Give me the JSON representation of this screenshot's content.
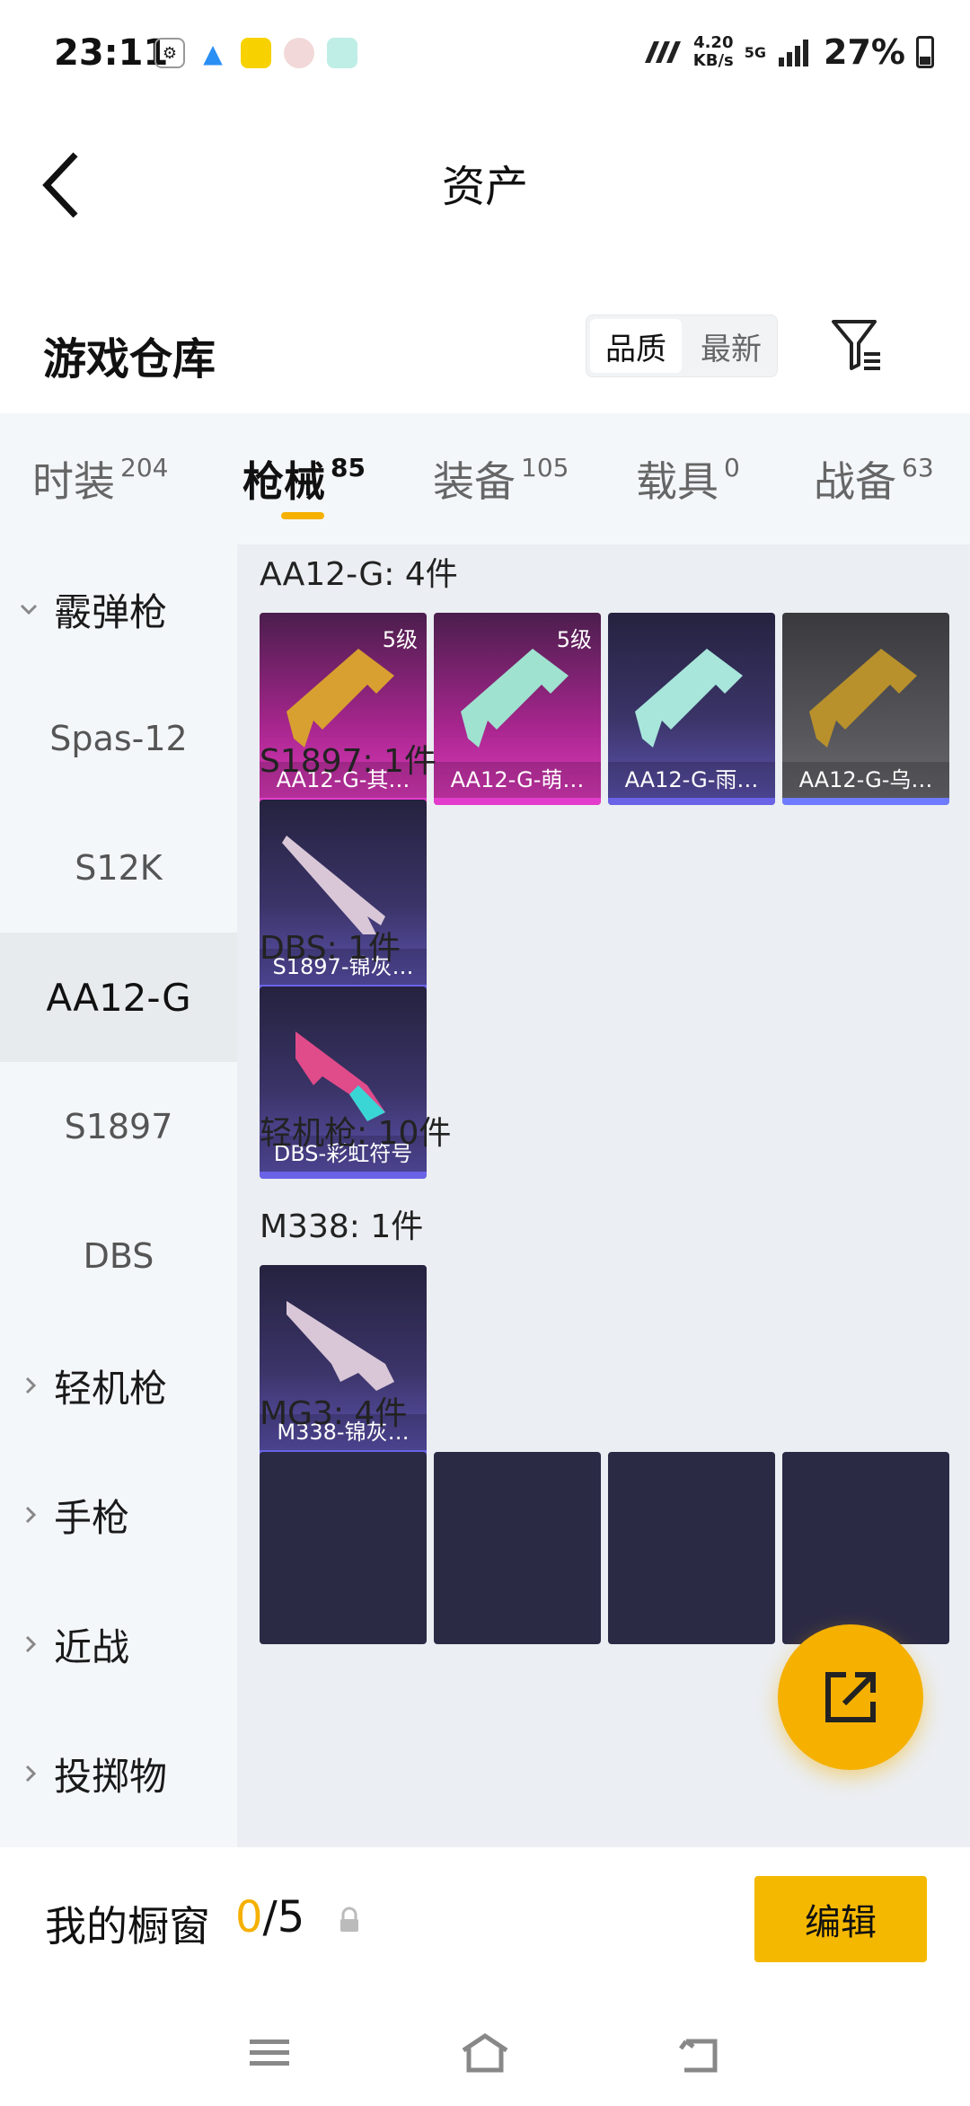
{
  "status_bar": {
    "time": "23:11",
    "speed_value": "4.20",
    "speed_unit": "KB/s",
    "network": "5G",
    "battery": "27%"
  },
  "header": {
    "title": "资产"
  },
  "section": {
    "title": "游戏仓库",
    "sort_options": [
      "品质",
      "最新"
    ],
    "active_sort": "品质"
  },
  "tabs": [
    {
      "label": "时装",
      "count": "204"
    },
    {
      "label": "枪械",
      "count": "85"
    },
    {
      "label": "装备",
      "count": "105"
    },
    {
      "label": "载具",
      "count": "0"
    },
    {
      "label": "战备",
      "count": "63"
    }
  ],
  "sidebar": {
    "items": [
      {
        "label": "霰弹枪"
      },
      {
        "label": "Spas-12"
      },
      {
        "label": "S12K"
      },
      {
        "label": "AA12-G"
      },
      {
        "label": "S1897"
      },
      {
        "label": "DBS"
      },
      {
        "label": "轻机枪"
      },
      {
        "label": "手枪"
      },
      {
        "label": "近战"
      },
      {
        "label": "投掷物"
      }
    ]
  },
  "content": {
    "groups": [
      {
        "label": "AA12-G: 4件"
      },
      {
        "label": "S1897: 1件"
      },
      {
        "label": "DBS: 1件"
      },
      {
        "label": "轻机枪: 10件"
      },
      {
        "label": "M338: 1件"
      },
      {
        "label": "MG3: 4件"
      }
    ],
    "cards": [
      {
        "name": "AA12-G-其…",
        "level": "5级"
      },
      {
        "name": "AA12-G-萌…",
        "level": "5级"
      },
      {
        "name": "AA12-G-雨…"
      },
      {
        "name": "AA12-G-乌…"
      },
      {
        "name": "S1897-锦灰…"
      },
      {
        "name": "DBS-彩虹符号"
      },
      {
        "name": "M338-锦灰…"
      }
    ]
  },
  "bottom_bar": {
    "label": "我的橱窗",
    "current": "0",
    "total": "/5",
    "edit_label": "编辑"
  },
  "colors": {
    "accent": "#f5b000"
  }
}
